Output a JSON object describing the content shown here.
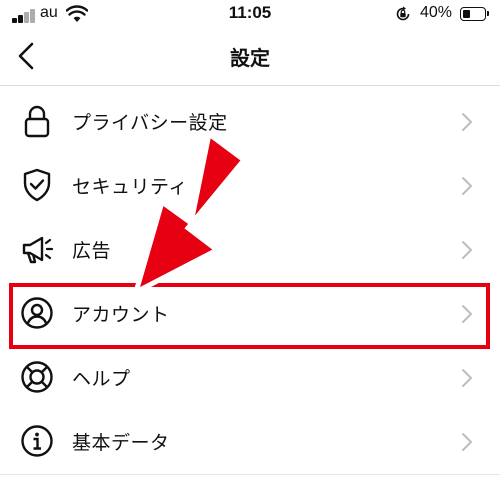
{
  "status_bar": {
    "carrier": "au",
    "time": "11:05",
    "battery_percent": "40%",
    "battery_level": 0.4,
    "icons": [
      "signal-icon",
      "wifi-icon",
      "rotation-lock-icon",
      "battery-icon"
    ]
  },
  "nav": {
    "title": "設定",
    "back_icon": "chevron-left-icon"
  },
  "menu": {
    "items": [
      {
        "label": "プライバシー設定",
        "icon": "lock-icon"
      },
      {
        "label": "セキュリティ",
        "icon": "shield-check-icon"
      },
      {
        "label": "広告",
        "icon": "megaphone-icon"
      },
      {
        "label": "アカウント",
        "icon": "account-icon"
      },
      {
        "label": "ヘルプ",
        "icon": "lifebuoy-icon"
      },
      {
        "label": "基本データ",
        "icon": "info-icon"
      }
    ]
  },
  "annotation": {
    "highlight_color": "#e60012",
    "highlighted_item": "アカウント"
  }
}
